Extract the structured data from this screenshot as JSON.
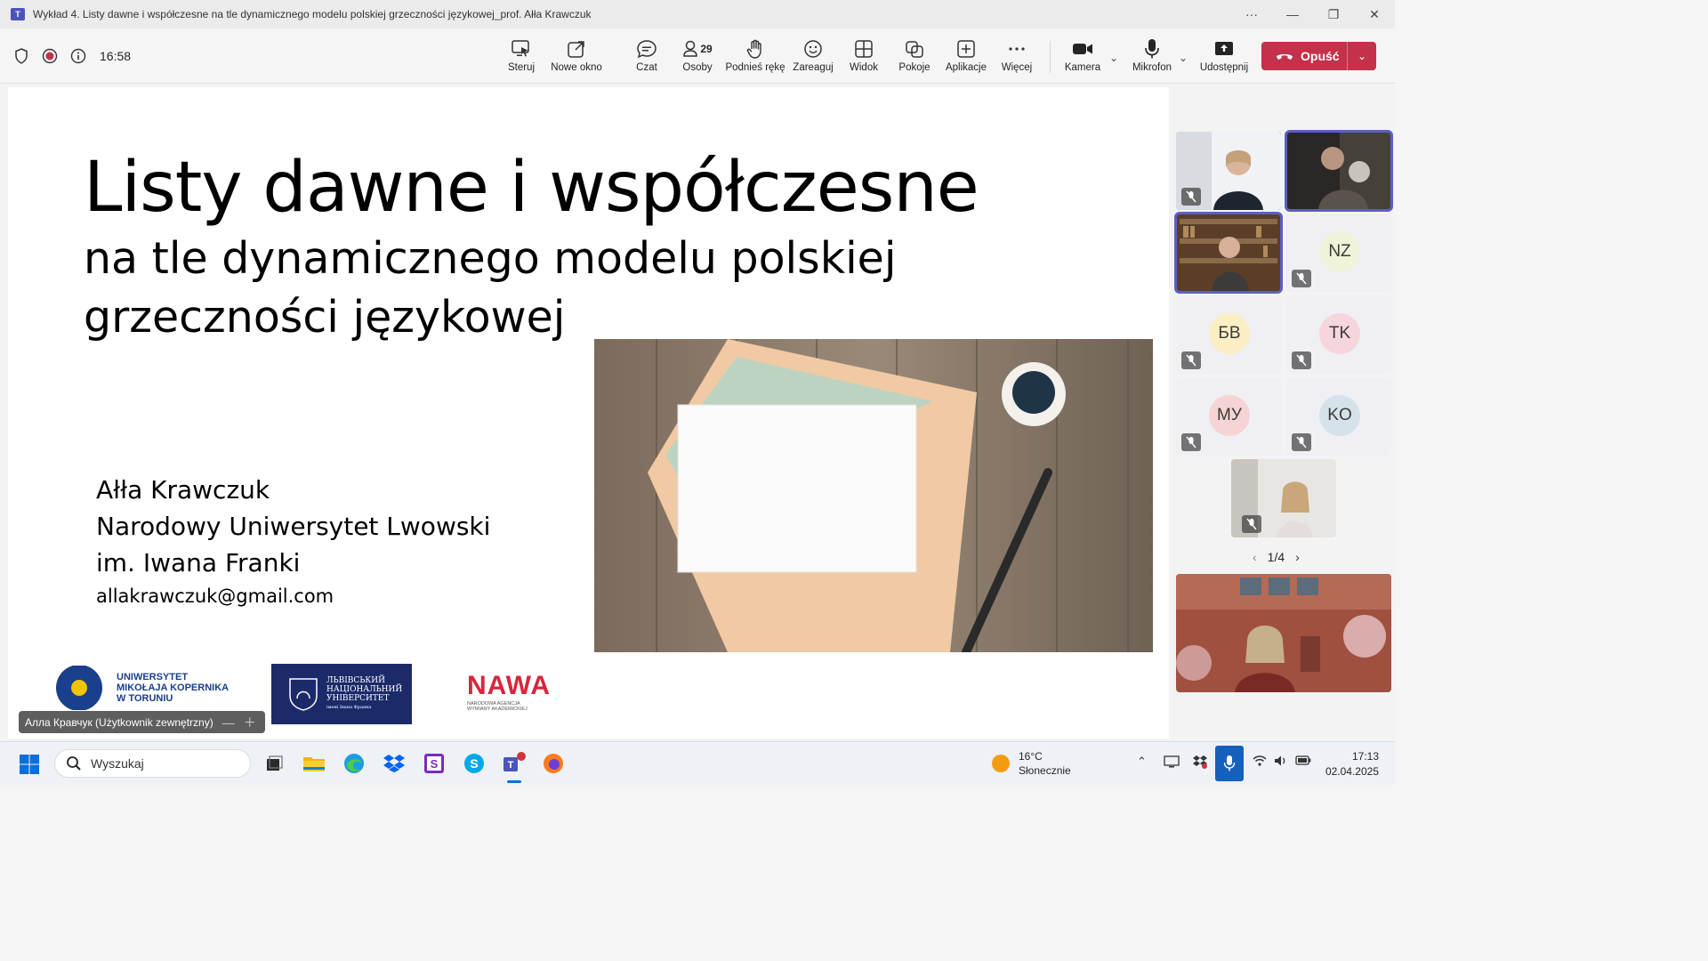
{
  "window": {
    "title": "Wykład 4. Listy dawne i współczesne na tle dynamicznego modelu polskiej grzeczności językowej_prof. Ałła Krawczuk",
    "minimize": "—",
    "maximize": "❐",
    "close": "✕",
    "more": "···"
  },
  "meeting": {
    "elapsed": "16:58",
    "toolbar": {
      "control": "Steruj",
      "new_window": "Nowe okno",
      "chat": "Czat",
      "people": "Osoby",
      "people_count": "29",
      "raise_hand": "Podnieś rękę",
      "react": "Zareaguj",
      "view": "Widok",
      "rooms": "Pokoje",
      "apps": "Aplikacje",
      "more": "Więcej",
      "camera": "Kamera",
      "mic": "Mikrofon",
      "share": "Udostępnij",
      "leave": "Opuść"
    },
    "accent_color": "#5b5fc7",
    "leave_color": "#c4314b"
  },
  "slide": {
    "title": "Listy dawne i współczesne",
    "subtitle": "na tle dynamicznego modelu polskiej grzeczności językowej",
    "author_name": "Ałła Krawczuk",
    "author_univ": "Narodowy Uniwersytet Lwowski",
    "author_univ2": "im. Iwana Franki",
    "email": "allakrawczuk@gmail.com",
    "logos": {
      "umk_line1": "UNIWERSYTET",
      "umk_line2": "MIKOŁAJA KOPERNIKA",
      "umk_line3": "W TORUNIU",
      "lnu_line1": "ЛЬВІВСЬКИЙ",
      "lnu_line2": "НАЦІОНАЛЬНИЙ",
      "lnu_line3": "УНІВЕРСИТЕТ",
      "lnu_line4": "імені Івана Франка",
      "nawa": "NAWA",
      "nawa_sub1": "NARODOWA AGENCJA",
      "nawa_sub2": "WYMIANY AKADEMICKIEJ"
    }
  },
  "presenter_tag": "Алла Кравчук (Użytkownik zewnętrzny)",
  "participants": [
    {
      "initials": "NZ",
      "color": "#eef3d9"
    },
    {
      "initials": "БВ",
      "color": "#fbeec2"
    },
    {
      "initials": "TK",
      "color": "#f7d5dc"
    },
    {
      "initials": "МУ",
      "color": "#f4d5d4"
    },
    {
      "initials": "KO",
      "color": "#d6e2ea"
    }
  ],
  "pager": "1/4",
  "taskbar": {
    "search_placeholder": "Wyszukaj",
    "weather_temp": "16°C",
    "weather_desc": "Słonecznie",
    "time": "17:13",
    "date": "02.04.2025"
  }
}
